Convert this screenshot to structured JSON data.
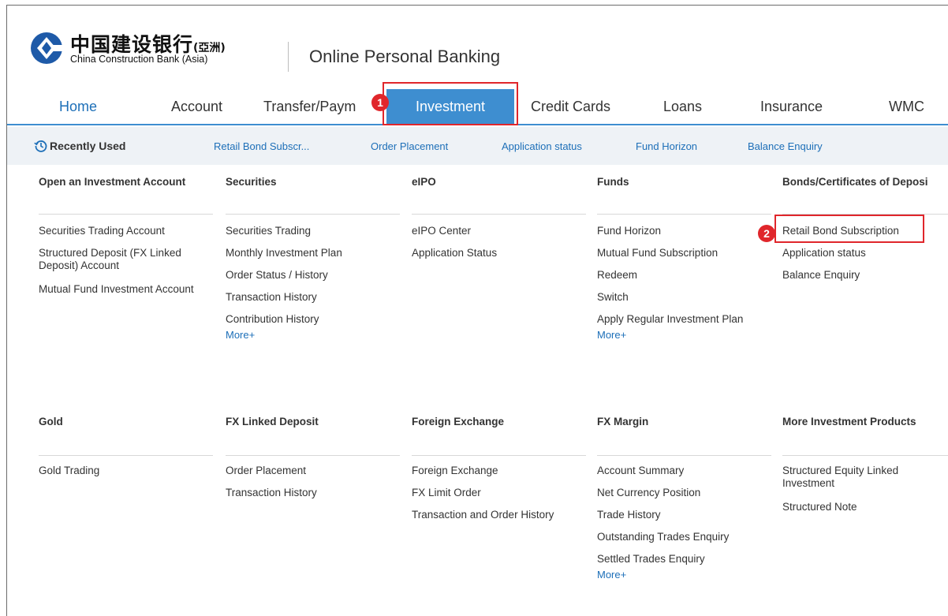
{
  "brand": {
    "name_cn": "中国建设银行",
    "name_cn_region": "(亞洲)",
    "name_en": "China Construction Bank (Asia)",
    "portal_title": "Online Personal Banking",
    "logo_color": "#1e5aa8"
  },
  "nav": {
    "items": [
      "Home",
      "Account",
      "Transfer/Paym",
      "Investment",
      "Credit Cards",
      "Loans",
      "Insurance",
      "WMC"
    ],
    "active": "Investment",
    "accent": "#3e8ed0"
  },
  "steps": {
    "one": "1",
    "two": "2"
  },
  "recent": {
    "title": "Recently Used",
    "links": [
      "Retail Bond Subscr...",
      "Order Placement",
      "Application status",
      "Fund Horizon",
      "Balance Enquiry"
    ]
  },
  "menu": {
    "row1": [
      {
        "heading": "Open an Investment Account",
        "links": [
          "Securities Trading Account",
          "Structured Deposit (FX Linked Deposit) Account",
          "Mutual Fund Investment Account"
        ]
      },
      {
        "heading": "Securities",
        "links": [
          "Securities Trading",
          "Monthly Investment Plan",
          "Order Status / History",
          "Transaction History",
          "Contribution History"
        ],
        "more": "More+"
      },
      {
        "heading": "eIPO",
        "links": [
          "eIPO Center",
          "Application Status"
        ]
      },
      {
        "heading": "Funds",
        "links": [
          "Fund Horizon",
          "Mutual Fund Subscription",
          "Redeem",
          "Switch",
          "Apply Regular Investment Plan"
        ],
        "more": "More+"
      },
      {
        "heading": "Bonds/Certificates of Deposi",
        "links": [
          "Retail Bond Subscription",
          "Application status",
          "Balance Enquiry"
        ]
      }
    ],
    "row2": [
      {
        "heading": "Gold",
        "links": [
          "Gold Trading"
        ]
      },
      {
        "heading": "FX Linked Deposit",
        "links": [
          "Order Placement",
          "Transaction History"
        ]
      },
      {
        "heading": "Foreign Exchange",
        "links": [
          "Foreign Exchange",
          "FX Limit Order",
          "Transaction and Order History"
        ]
      },
      {
        "heading": "FX Margin",
        "links": [
          "Account Summary",
          "Net Currency Position",
          "Trade History",
          "Outstanding Trades Enquiry",
          "Settled Trades Enquiry"
        ],
        "more": "More+"
      },
      {
        "heading": "More Investment Products",
        "links": [
          "Structured Equity Linked Investment",
          "Structured Note"
        ]
      }
    ]
  }
}
